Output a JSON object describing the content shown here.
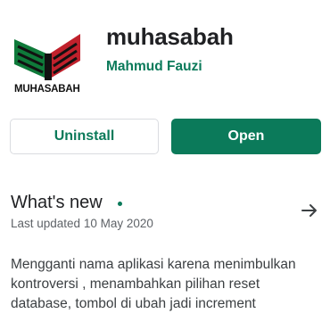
{
  "app": {
    "title": "muhasabah",
    "developer": "Mahmud Fauzi",
    "icon": {
      "name": "muhasabah-book-icon",
      "label": "MUHASABAH",
      "colors": {
        "green": "#0f7a3a",
        "red": "#c0212c",
        "dark": "#111111"
      }
    }
  },
  "actions": {
    "uninstall_label": "Uninstall",
    "open_label": "Open"
  },
  "whats_new": {
    "title": "What's new",
    "updated": "Last updated 10 May 2020",
    "arrow_icon": "arrow-right-icon",
    "notes_lines": [
      "Mengganti nama aplikasi karena menimbulkan",
      "kontroversi , menambahkan pilihan reset",
      "database, tombol di ubah jadi increment"
    ]
  },
  "colors": {
    "accent": "#0b7a5a",
    "text_primary": "#202124",
    "text_secondary": "#5f6368",
    "border": "#dadce0"
  }
}
